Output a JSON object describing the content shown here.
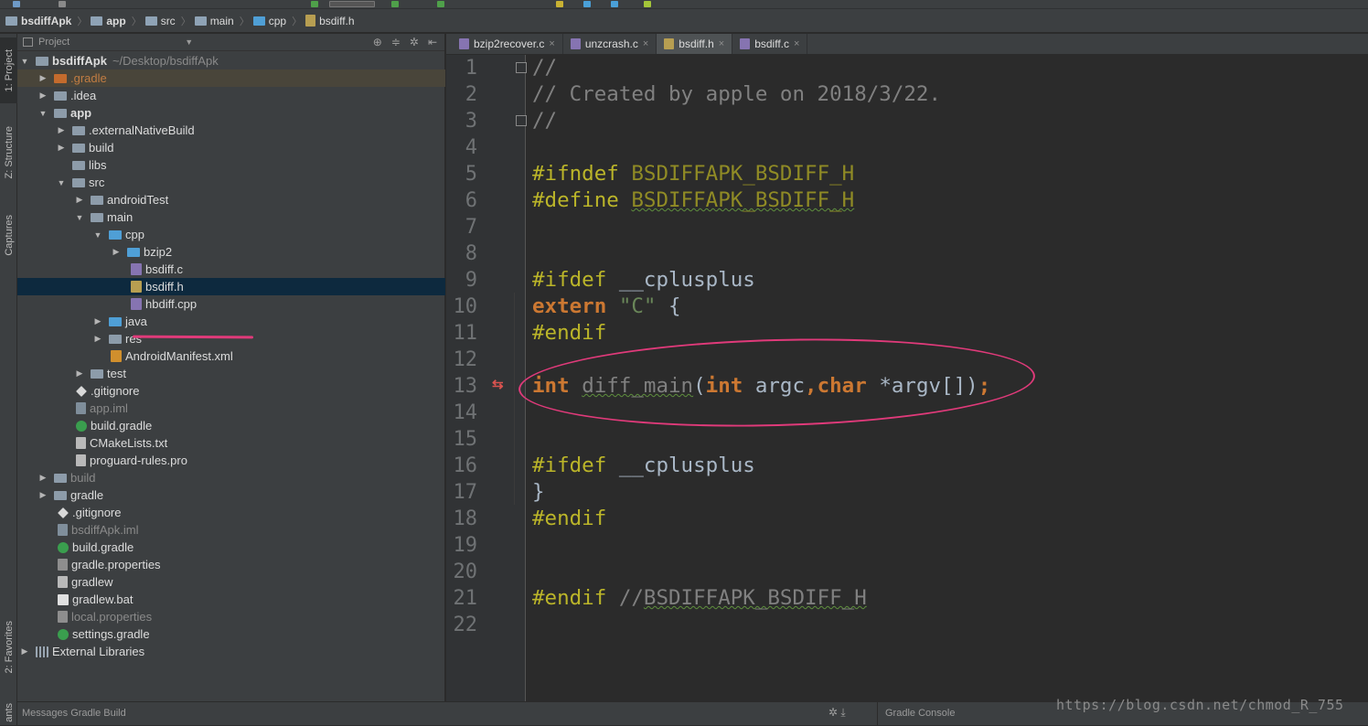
{
  "breadcrumbs": [
    {
      "label": "bsdiffApk",
      "bold": true
    },
    {
      "label": "app",
      "bold": true
    },
    {
      "label": "src"
    },
    {
      "label": "main"
    },
    {
      "label": "cpp"
    },
    {
      "label": "bsdiff.h"
    }
  ],
  "left_strip": {
    "project": "1: Project",
    "structure": "Z: Structure",
    "captures": "Captures",
    "favorites": "2: Favorites",
    "variants": "ants"
  },
  "project_panel": {
    "title": "Project"
  },
  "tree": [
    {
      "label": "bsdiffApk",
      "path": "~/Desktop/bsdiffApk"
    },
    {
      "label": ".gradle"
    },
    {
      "label": ".idea"
    },
    {
      "label": "app"
    },
    {
      "label": ".externalNativeBuild"
    },
    {
      "label": "build"
    },
    {
      "label": "libs"
    },
    {
      "label": "src"
    },
    {
      "label": "androidTest"
    },
    {
      "label": "main"
    },
    {
      "label": "cpp"
    },
    {
      "label": "bzip2"
    },
    {
      "label": "bsdiff.c"
    },
    {
      "label": "bsdiff.h"
    },
    {
      "label": "hbdiff.cpp"
    },
    {
      "label": "java"
    },
    {
      "label": "res"
    },
    {
      "label": "AndroidManifest.xml"
    },
    {
      "label": "test"
    },
    {
      "label": ".gitignore"
    },
    {
      "label": "app.iml"
    },
    {
      "label": "build.gradle"
    },
    {
      "label": "CMakeLists.txt"
    },
    {
      "label": "proguard-rules.pro"
    },
    {
      "label": "build"
    },
    {
      "label": "gradle"
    },
    {
      "label": ".gitignore"
    },
    {
      "label": "bsdiffApk.iml"
    },
    {
      "label": "build.gradle"
    },
    {
      "label": "gradle.properties"
    },
    {
      "label": "gradlew"
    },
    {
      "label": "gradlew.bat"
    },
    {
      "label": "local.properties"
    },
    {
      "label": "settings.gradle"
    },
    {
      "label": "External Libraries"
    }
  ],
  "tabs": [
    {
      "label": "bzip2recover.c"
    },
    {
      "label": "unzcrash.c"
    },
    {
      "label": "bsdiff.h"
    },
    {
      "label": "bsdiff.c"
    }
  ],
  "code": {
    "line_numbers": [
      "1",
      "2",
      "3",
      "4",
      "5",
      "6",
      "7",
      "8",
      "9",
      "10",
      "11",
      "12",
      "13",
      "14",
      "15",
      "16",
      "17",
      "18",
      "19",
      "20",
      "21",
      "22"
    ],
    "l1": "//",
    "l2": "// Created by apple on 2018/3/22.",
    "l3": "//",
    "l5_kw": "#ifndef ",
    "l5_macro": "BSDIFFAPK_BSDIFF_H",
    "l6_kw": "#define ",
    "l6_macro": "BSDIFFAPK_BSDIFF_H",
    "l9_kw": "#ifdef ",
    "l9_tx": "__cplusplus",
    "l10_kw": "extern ",
    "l10_str": "\"C\"",
    "l10_tx": " {",
    "l11_kw": "#endif",
    "l13_int": "int ",
    "l13_fn": "diff_main",
    "l13_p1": "(",
    "l13_int2": "int ",
    "l13_argc": "argc",
    "l13_comma": ",",
    "l13_char": "char ",
    "l13_argv": "*argv[])",
    "l13_semi": ";",
    "l16_kw": "#ifdef ",
    "l16_tx": "__cplusplus",
    "l17": "}",
    "l18_kw": "#endif",
    "l21_kw": "#endif ",
    "l21_cm": "//",
    "l21_cm2": "BSDIFFAPK_BSDIFF_H"
  },
  "bottom": {
    "messages": "Messages Gradle Build",
    "console": "Gradle Console"
  },
  "watermark": "https://blog.csdn.net/chmod_R_755",
  "colors": {
    "keyword": "#cc7832",
    "preprocessor": "#bbb529",
    "string": "#6a8759",
    "annotation": "#e03a7a",
    "selection": "#0d293e"
  }
}
